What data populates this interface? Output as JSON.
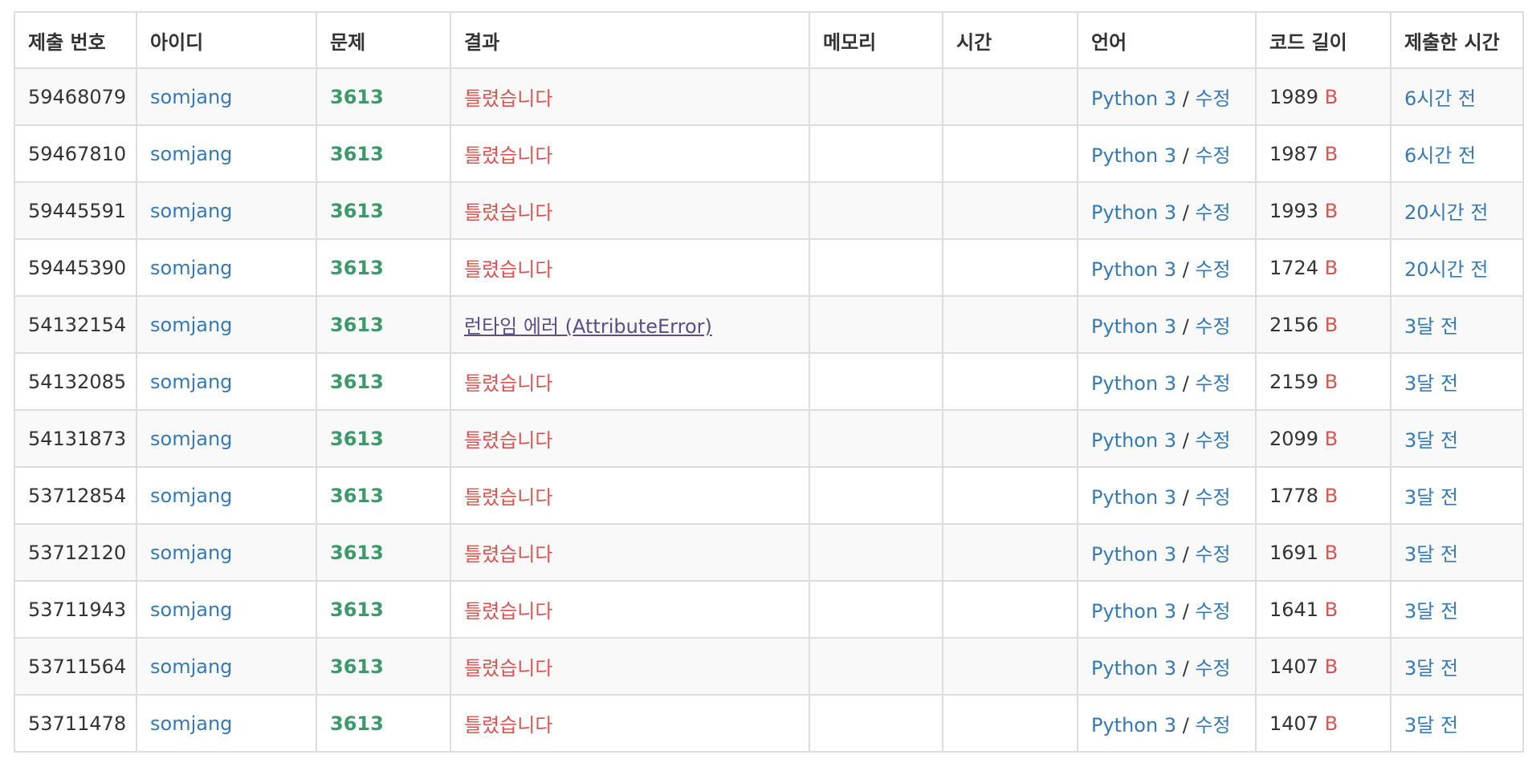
{
  "colors": {
    "link": "#337ab7",
    "problem": "#3c9a6a",
    "wrong": "#d9534f",
    "runtime": "#5d4c87",
    "border": "#dddddd",
    "stripe": "#f9f9f9"
  },
  "headers": [
    "제출 번호",
    "아이디",
    "문제",
    "결과",
    "메모리",
    "시간",
    "언어",
    "코드 길이",
    "제출한 시간"
  ],
  "rows": [
    {
      "id": "59468079",
      "user": "somjang",
      "problem": "3613",
      "result": "틀렸습니다",
      "result_type": "wrong",
      "memory": "",
      "time": "",
      "lang": "Python 3",
      "sep": " / ",
      "edit": "수정",
      "length": "1989",
      "unit": "B",
      "submitted": "6시간 전"
    },
    {
      "id": "59467810",
      "user": "somjang",
      "problem": "3613",
      "result": "틀렸습니다",
      "result_type": "wrong",
      "memory": "",
      "time": "",
      "lang": "Python 3",
      "sep": " / ",
      "edit": "수정",
      "length": "1987",
      "unit": "B",
      "submitted": "6시간 전"
    },
    {
      "id": "59445591",
      "user": "somjang",
      "problem": "3613",
      "result": "틀렸습니다",
      "result_type": "wrong",
      "memory": "",
      "time": "",
      "lang": "Python 3",
      "sep": " / ",
      "edit": "수정",
      "length": "1993",
      "unit": "B",
      "submitted": "20시간 전"
    },
    {
      "id": "59445390",
      "user": "somjang",
      "problem": "3613",
      "result": "틀렸습니다",
      "result_type": "wrong",
      "memory": "",
      "time": "",
      "lang": "Python 3",
      "sep": " / ",
      "edit": "수정",
      "length": "1724",
      "unit": "B",
      "submitted": "20시간 전"
    },
    {
      "id": "54132154",
      "user": "somjang",
      "problem": "3613",
      "result": "런타임 에러 (AttributeError)",
      "result_type": "runtime",
      "memory": "",
      "time": "",
      "lang": "Python 3",
      "sep": " / ",
      "edit": "수정",
      "length": "2156",
      "unit": "B",
      "submitted": "3달 전"
    },
    {
      "id": "54132085",
      "user": "somjang",
      "problem": "3613",
      "result": "틀렸습니다",
      "result_type": "wrong",
      "memory": "",
      "time": "",
      "lang": "Python 3",
      "sep": " / ",
      "edit": "수정",
      "length": "2159",
      "unit": "B",
      "submitted": "3달 전"
    },
    {
      "id": "54131873",
      "user": "somjang",
      "problem": "3613",
      "result": "틀렸습니다",
      "result_type": "wrong",
      "memory": "",
      "time": "",
      "lang": "Python 3",
      "sep": " / ",
      "edit": "수정",
      "length": "2099",
      "unit": "B",
      "submitted": "3달 전"
    },
    {
      "id": "53712854",
      "user": "somjang",
      "problem": "3613",
      "result": "틀렸습니다",
      "result_type": "wrong",
      "memory": "",
      "time": "",
      "lang": "Python 3",
      "sep": " / ",
      "edit": "수정",
      "length": "1778",
      "unit": "B",
      "submitted": "3달 전"
    },
    {
      "id": "53712120",
      "user": "somjang",
      "problem": "3613",
      "result": "틀렸습니다",
      "result_type": "wrong",
      "memory": "",
      "time": "",
      "lang": "Python 3",
      "sep": " / ",
      "edit": "수정",
      "length": "1691",
      "unit": "B",
      "submitted": "3달 전"
    },
    {
      "id": "53711943",
      "user": "somjang",
      "problem": "3613",
      "result": "틀렸습니다",
      "result_type": "wrong",
      "memory": "",
      "time": "",
      "lang": "Python 3",
      "sep": " / ",
      "edit": "수정",
      "length": "1641",
      "unit": "B",
      "submitted": "3달 전"
    },
    {
      "id": "53711564",
      "user": "somjang",
      "problem": "3613",
      "result": "틀렸습니다",
      "result_type": "wrong",
      "memory": "",
      "time": "",
      "lang": "Python 3",
      "sep": " / ",
      "edit": "수정",
      "length": "1407",
      "unit": "B",
      "submitted": "3달 전"
    },
    {
      "id": "53711478",
      "user": "somjang",
      "problem": "3613",
      "result": "틀렸습니다",
      "result_type": "wrong",
      "memory": "",
      "time": "",
      "lang": "Python 3",
      "sep": " / ",
      "edit": "수정",
      "length": "1407",
      "unit": "B",
      "submitted": "3달 전"
    }
  ]
}
